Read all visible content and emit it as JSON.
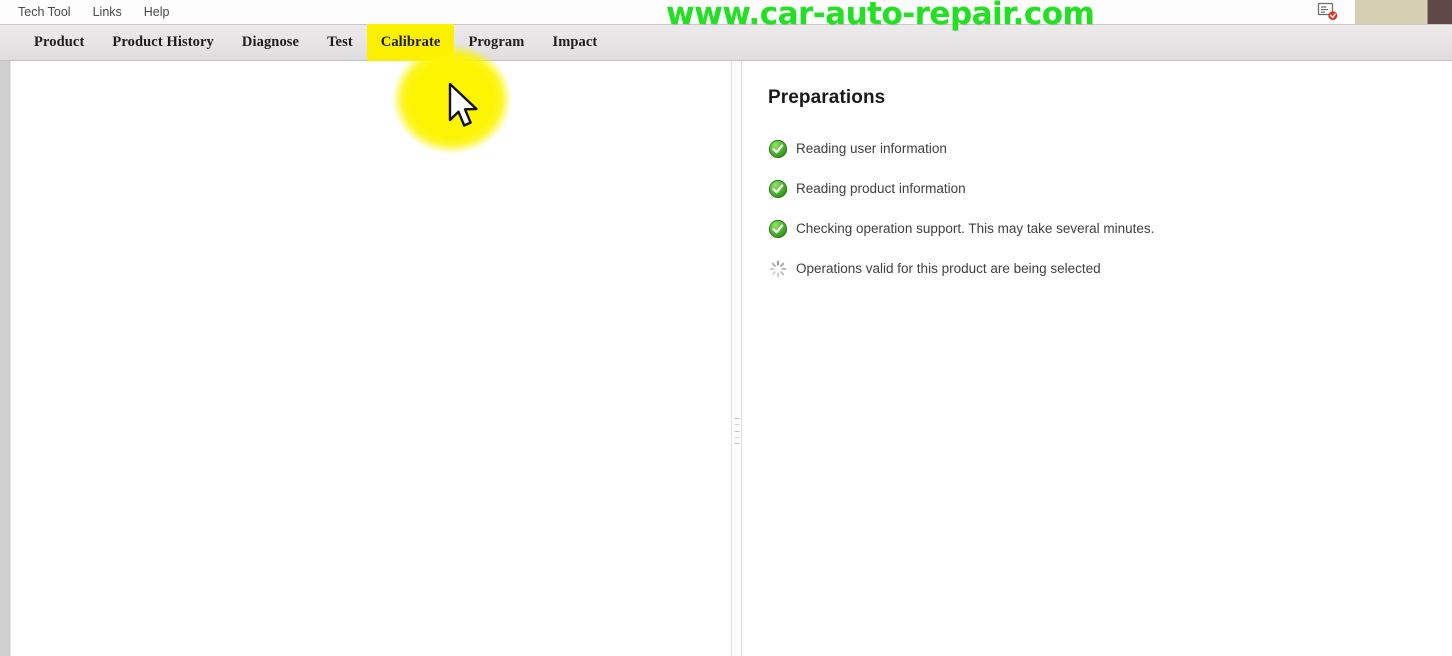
{
  "window": {
    "title": "Tech Tool"
  },
  "menubar": {
    "items": [
      {
        "label": "Tech Tool",
        "name": "menu-item-tech-tool"
      },
      {
        "label": "Links",
        "name": "menu-item-links"
      },
      {
        "label": "Help",
        "name": "menu-item-help"
      }
    ],
    "message_icon": "message-alert-icon",
    "swatch_tan_color": "#d6cfb4",
    "swatch_brown_color": "#5e4745"
  },
  "tabs": {
    "selected": "Calibrate",
    "selected_color": "#fbf000",
    "items": [
      {
        "label": "Product",
        "name": "tab-product",
        "selected": false
      },
      {
        "label": "Product History",
        "name": "tab-product-history",
        "selected": false
      },
      {
        "label": "Diagnose",
        "name": "tab-diagnose",
        "selected": false
      },
      {
        "label": "Test",
        "name": "tab-test",
        "selected": false
      },
      {
        "label": "Calibrate",
        "name": "tab-calibrate",
        "selected": true
      },
      {
        "label": "Program",
        "name": "tab-program",
        "selected": false
      },
      {
        "label": "Impact",
        "name": "tab-impact",
        "selected": false
      }
    ]
  },
  "panel": {
    "title": "Preparations",
    "tasks": [
      {
        "label": "Reading user information",
        "status": "done",
        "icon": "green-check-icon"
      },
      {
        "label": "Reading product information",
        "status": "done",
        "icon": "green-check-icon"
      },
      {
        "label": "Checking operation support. This may take several minutes.",
        "status": "done",
        "icon": "green-check-icon"
      },
      {
        "label": "Operations valid for this product are being selected",
        "status": "in-progress",
        "icon": "loading-spinner-icon"
      }
    ],
    "status_done_color": "#3fa32a",
    "status_pending_color": "#b5b5b5"
  },
  "overlay": {
    "watermark": "www.car-auto-repair.com",
    "watermark_color": "#22e022",
    "highlight_color": "#fcf400",
    "cursor": "mouse-pointer-cursor"
  }
}
